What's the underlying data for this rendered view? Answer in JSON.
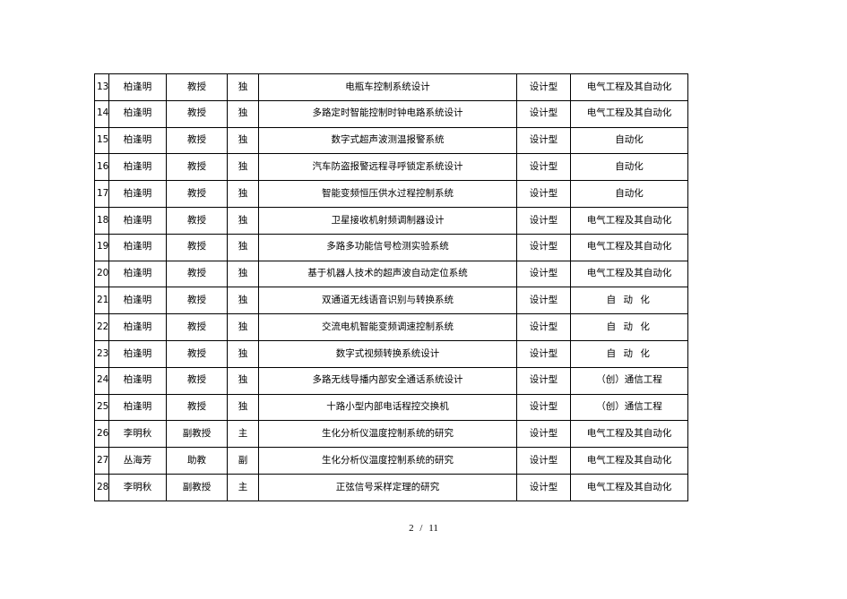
{
  "document": {
    "page_footer": {
      "current_page": "2",
      "separator": "/",
      "total_pages": "11"
    }
  },
  "table": {
    "columns": [
      {
        "key": "no",
        "name": "serial-number"
      },
      {
        "key": "name",
        "name": "teacher-name"
      },
      {
        "key": "title",
        "name": "academic-title"
      },
      {
        "key": "role",
        "name": "participation-role"
      },
      {
        "key": "proj",
        "name": "project-title"
      },
      {
        "key": "type",
        "name": "project-type"
      },
      {
        "key": "major",
        "name": "major-field"
      }
    ],
    "rows": [
      {
        "no": "13",
        "name": "柏逢明",
        "title": "教授",
        "role": "独",
        "proj": "电瓶车控制系统设计",
        "type": "设计型",
        "major": "电气工程及其自动化",
        "spaced": false
      },
      {
        "no": "14",
        "name": "柏逢明",
        "title": "教授",
        "role": "独",
        "proj": "多路定时智能控制时钟电路系统设计",
        "type": "设计型",
        "major": "电气工程及其自动化",
        "spaced": false
      },
      {
        "no": "15",
        "name": "柏逢明",
        "title": "教授",
        "role": "独",
        "proj": "数字式超声波测温报警系统",
        "type": "设计型",
        "major": "自动化",
        "spaced": false
      },
      {
        "no": "16",
        "name": "柏逢明",
        "title": "教授",
        "role": "独",
        "proj": "汽车防盗报警远程寻呼锁定系统设计",
        "type": "设计型",
        "major": "自动化",
        "spaced": false
      },
      {
        "no": "17",
        "name": "柏逢明",
        "title": "教授",
        "role": "独",
        "proj": "智能变频恒压供水过程控制系统",
        "type": "设计型",
        "major": "自动化",
        "spaced": false
      },
      {
        "no": "18",
        "name": "柏逢明",
        "title": "教授",
        "role": "独",
        "proj": "卫星接收机射频调制器设计",
        "type": "设计型",
        "major": "电气工程及其自动化",
        "spaced": false
      },
      {
        "no": "19",
        "name": "柏逢明",
        "title": "教授",
        "role": "独",
        "proj": "多路多功能信号检测实验系统",
        "type": "设计型",
        "major": "电气工程及其自动化",
        "spaced": false
      },
      {
        "no": "20",
        "name": "柏逢明",
        "title": "教授",
        "role": "独",
        "proj": "基于机器人技术的超声波自动定位系统",
        "type": "设计型",
        "major": "电气工程及其自动化",
        "spaced": false
      },
      {
        "no": "21",
        "name": "柏逢明",
        "title": "教授",
        "role": "独",
        "proj": "双通道无线语音识别与转换系统",
        "type": "设计型",
        "major": "自 动 化",
        "spaced": true
      },
      {
        "no": "22",
        "name": "柏逢明",
        "title": "教授",
        "role": "独",
        "proj": "交流电机智能变频调速控制系统",
        "type": "设计型",
        "major": "自 动 化",
        "spaced": true
      },
      {
        "no": "23",
        "name": "柏逢明",
        "title": "教授",
        "role": "独",
        "proj": "数字式视频转换系统设计",
        "type": "设计型",
        "major": "自 动 化",
        "spaced": true
      },
      {
        "no": "24",
        "name": "柏逢明",
        "title": "教授",
        "role": "独",
        "proj": "多路无线导播内部安全通话系统设计",
        "type": "设计型",
        "major": "（创）通信工程",
        "spaced": false
      },
      {
        "no": "25",
        "name": "柏逢明",
        "title": "教授",
        "role": "独",
        "proj": "十路小型内部电话程控交换机",
        "type": "设计型",
        "major": "（创）通信工程",
        "spaced": false
      },
      {
        "no": "26",
        "name": "李明秋",
        "title": "副教授",
        "role": "主",
        "proj": "生化分析仪温度控制系统的研究",
        "type": "设计型",
        "major": "电气工程及其自动化",
        "spaced": false
      },
      {
        "no": "27",
        "name": "丛海芳",
        "title": "助教",
        "role": "副",
        "proj": "生化分析仪温度控制系统的研究",
        "type": "设计型",
        "major": "电气工程及其自动化",
        "spaced": false
      },
      {
        "no": "28",
        "name": "李明秋",
        "title": "副教授",
        "role": "主",
        "proj": "正弦信号采样定理的研究",
        "type": "设计型",
        "major": "电气工程及其自动化",
        "spaced": false
      }
    ]
  }
}
